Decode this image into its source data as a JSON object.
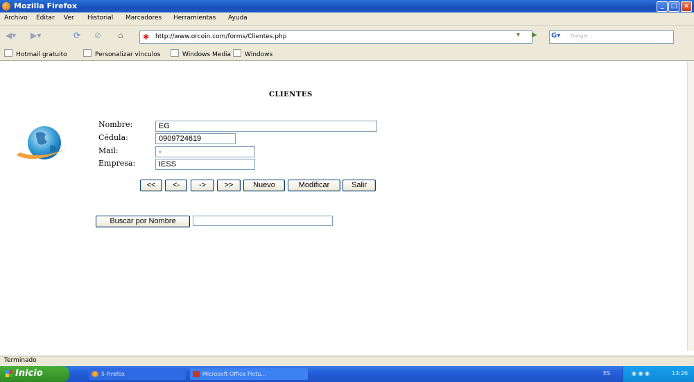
{
  "window": {
    "title": "Mozilla Firefox"
  },
  "menu": [
    "Archivo",
    "Editar",
    "Ver",
    "Historial",
    "Marcadores",
    "Herramientas",
    "Ayuda"
  ],
  "address": {
    "url": "http://www.orcoin.com/forms/Clientes.php"
  },
  "search": {
    "placeholder": "Google"
  },
  "bookmarks": [
    "Hotmail gratuito",
    "Personalizar vínculos",
    "Windows Media",
    "Windows"
  ],
  "page": {
    "title": "CLIENTES",
    "fields": {
      "nombre": {
        "label": "Nombre:",
        "value": "EG"
      },
      "cedula": {
        "label": "Cédula:",
        "value": "0909724619"
      },
      "mail": {
        "label": "Mail:",
        "value": "-"
      },
      "empresa": {
        "label": "Empresa:",
        "value": "IESS"
      }
    },
    "nav_buttons": {
      "first": "<<",
      "prev": "<-",
      "next": "->",
      "last": ">>"
    },
    "action_buttons": {
      "nuevo": "Nuevo",
      "modificar": "Modificar",
      "salir": "Salir"
    },
    "search_button": "Buscar por Nombre",
    "search_value": ""
  },
  "status": {
    "text": "Terminado"
  },
  "taskbar": {
    "start": "Inicio",
    "tasks": [
      "5 Firefox",
      "Microsoft Office Pictu..."
    ],
    "lang": "ES",
    "clock": "13:26"
  },
  "colors": {
    "accent": "#245edb",
    "start": "#3c9a2e",
    "chrome": "#ece9d8"
  }
}
